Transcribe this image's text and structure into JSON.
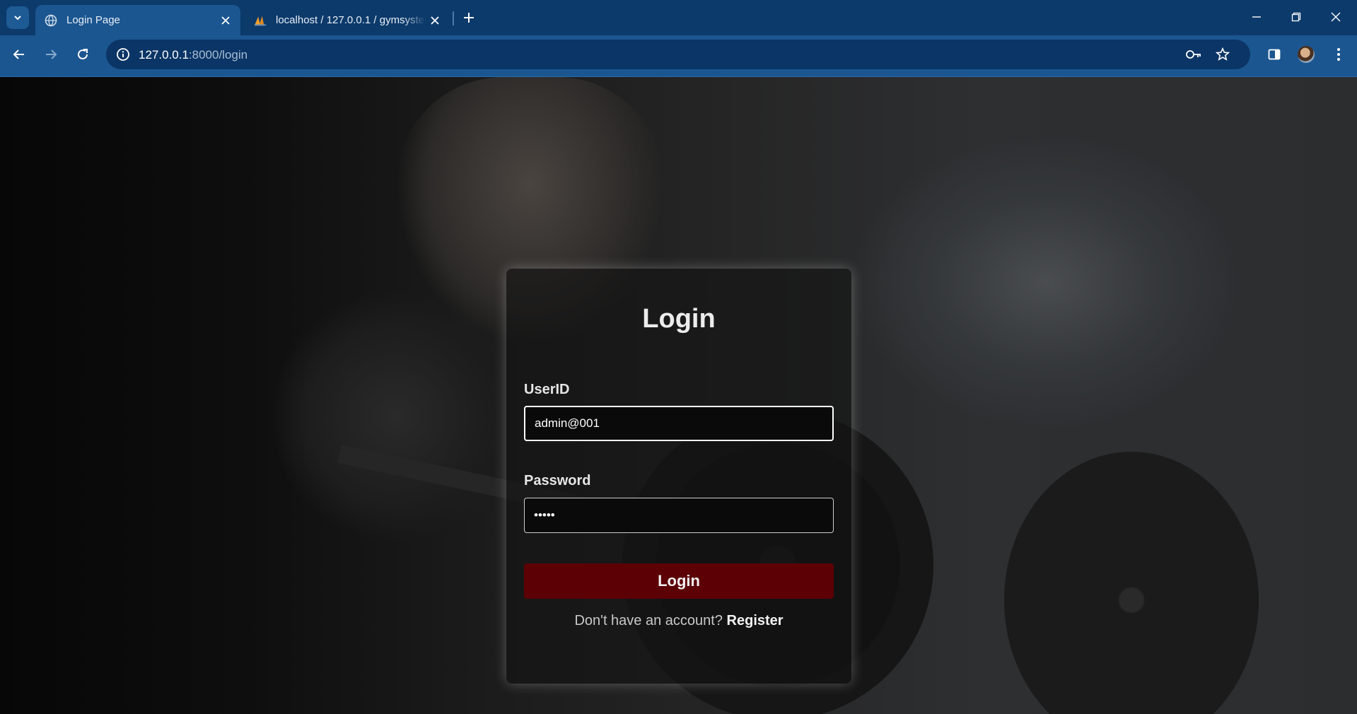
{
  "browser": {
    "tabs": [
      {
        "title": "Login Page",
        "favicon": "globe-icon",
        "active": true
      },
      {
        "title": "localhost / 127.0.0.1 / gymsystem",
        "favicon": "phpmyadmin-icon",
        "active": false
      }
    ],
    "address": {
      "host": "127.0.0.1",
      "path": ":8000/login"
    }
  },
  "login": {
    "title": "Login",
    "userid_label": "UserID",
    "userid_value": "admin@001",
    "password_label": "Password",
    "password_value": "•••••",
    "submit_label": "Login",
    "register_prompt": "Don't have an account?",
    "register_link": "Register"
  },
  "colors": {
    "chrome": "#0c3a6b",
    "toolbar": "#1b5690",
    "button": "#5c0006"
  }
}
